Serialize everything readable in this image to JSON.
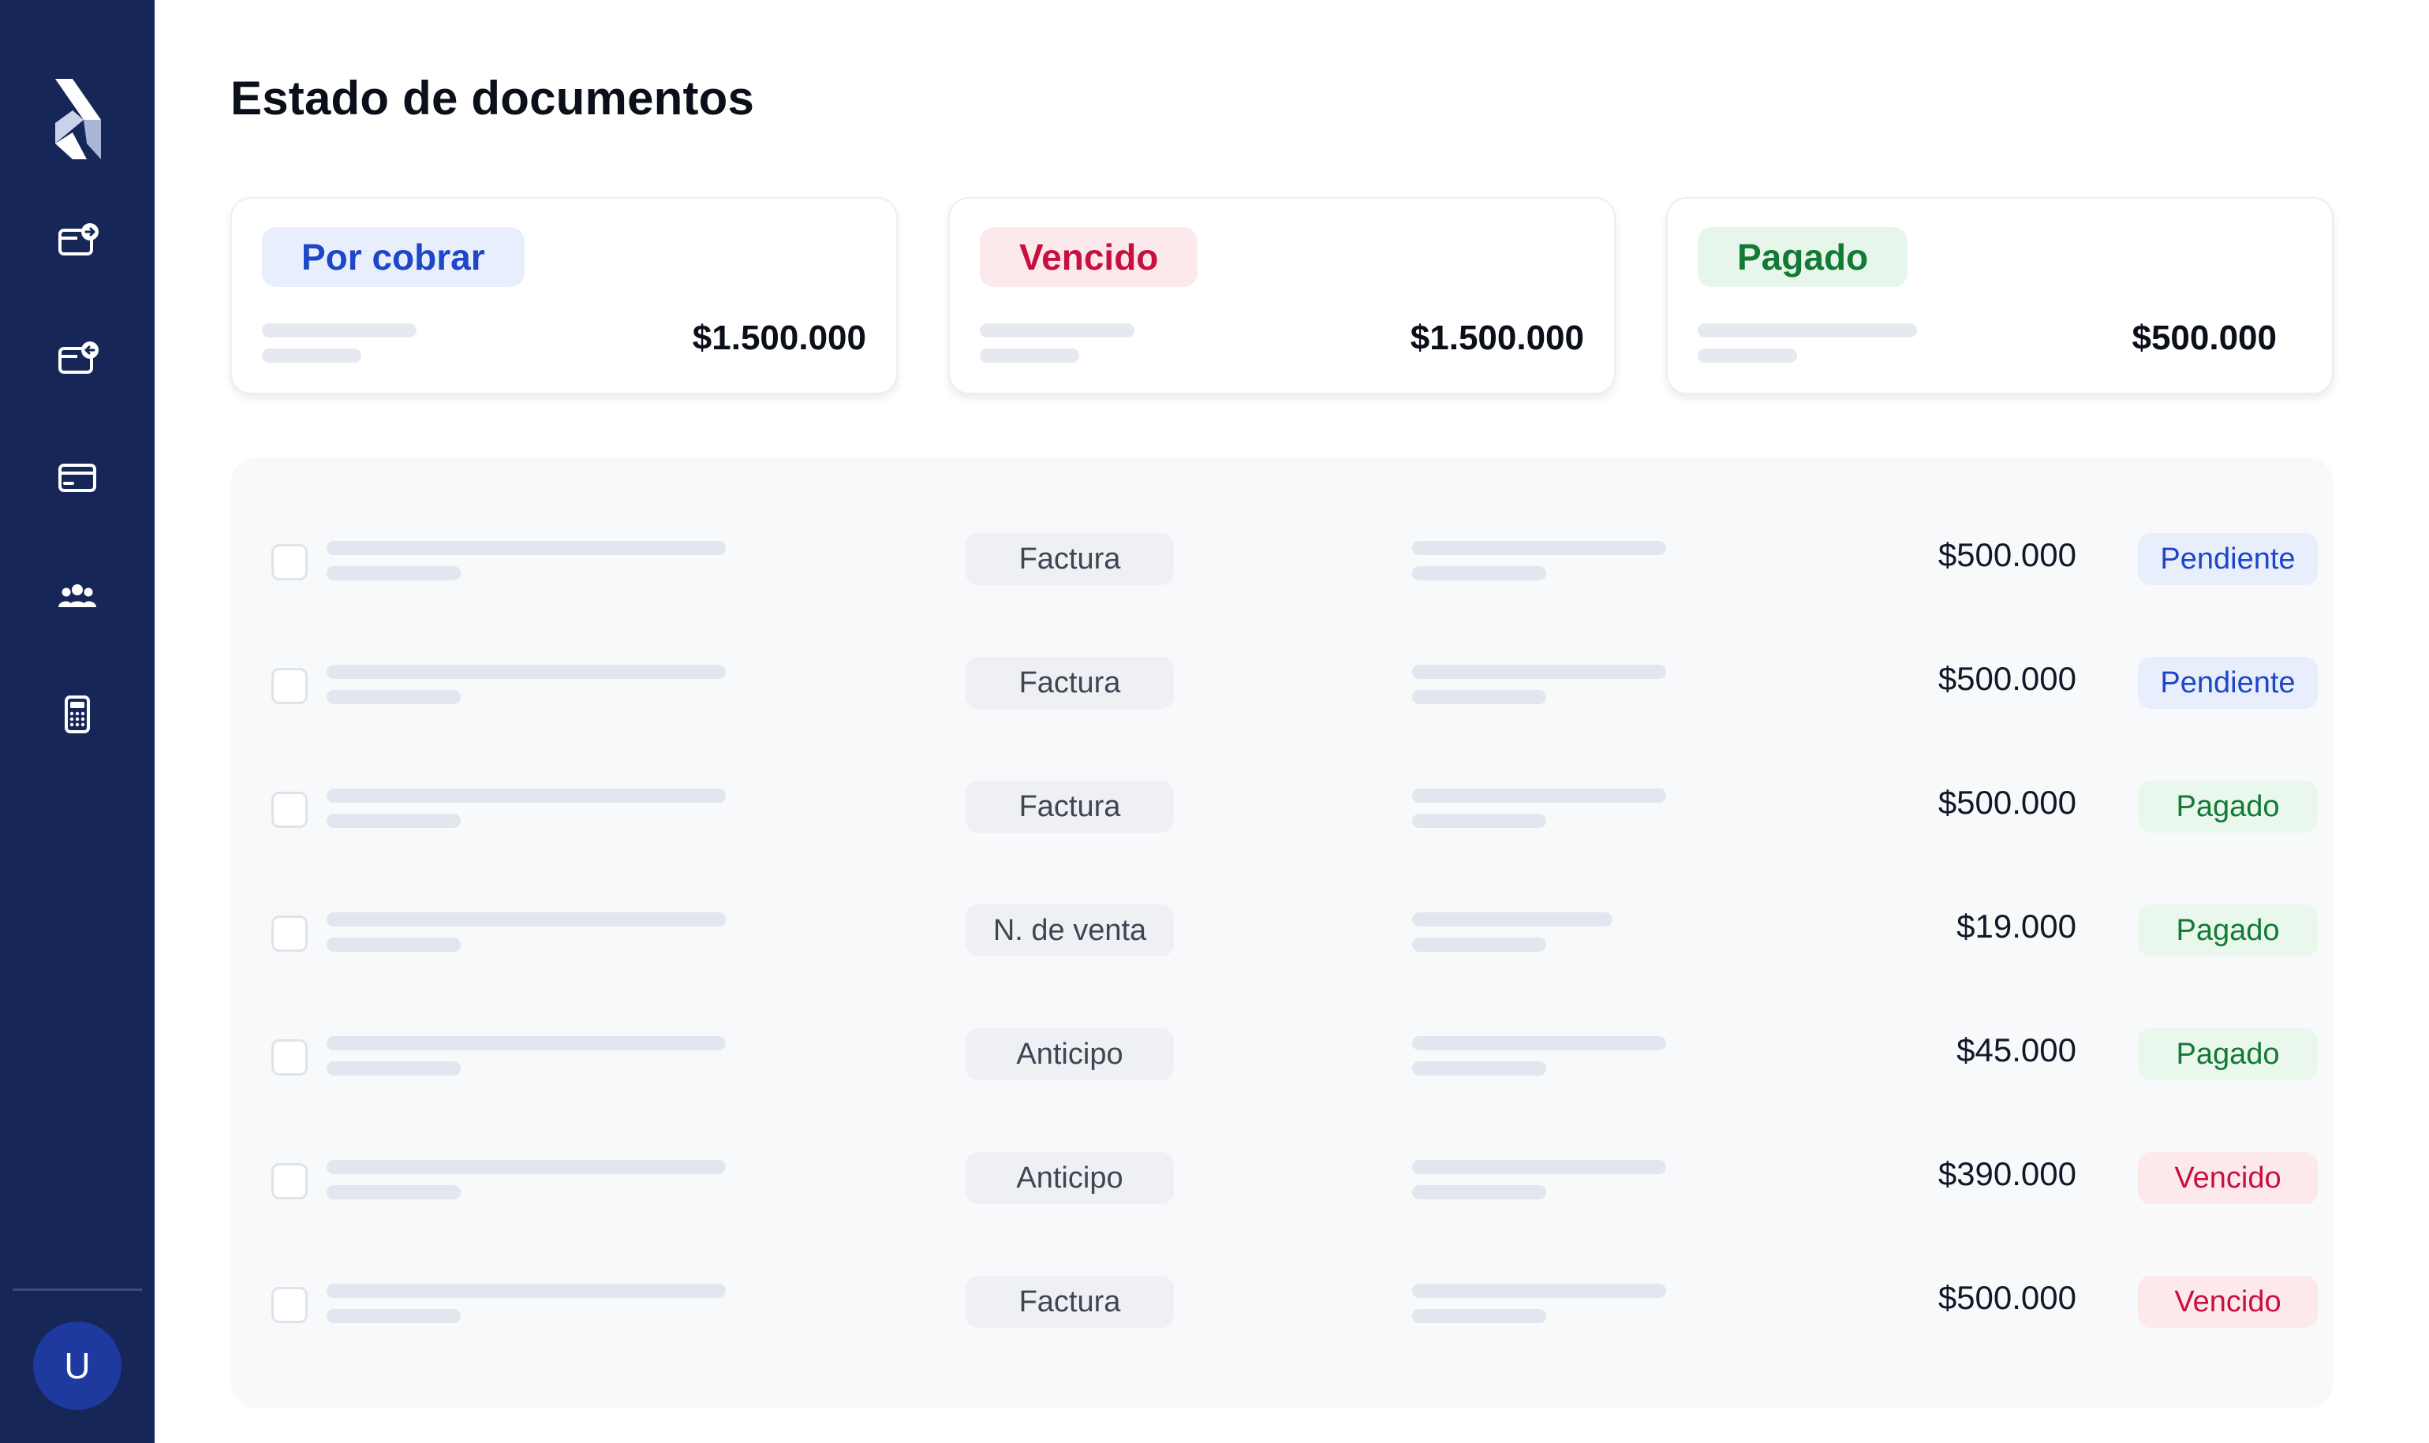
{
  "sidebar": {
    "logo_icon": "brand-x-logo",
    "nav": [
      {
        "icon": "wallet-outgoing-icon"
      },
      {
        "icon": "wallet-incoming-icon"
      },
      {
        "icon": "credit-card-icon"
      },
      {
        "icon": "users-group-icon"
      },
      {
        "icon": "calculator-icon"
      }
    ],
    "avatar_initial": "U"
  },
  "page": {
    "title": "Estado de documentos"
  },
  "summary": [
    {
      "label": "Por cobrar",
      "amount": "$1.500.000",
      "tone": "blue"
    },
    {
      "label": "Vencido",
      "amount": "$1.500.000",
      "tone": "red"
    },
    {
      "label": "Pagado",
      "amount": "$500.000",
      "tone": "green"
    }
  ],
  "documents": [
    {
      "type": "Factura",
      "amount": "$500.000",
      "status": "Pendiente",
      "status_tone": "pendiente"
    },
    {
      "type": "Factura",
      "amount": "$500.000",
      "status": "Pendiente",
      "status_tone": "pendiente"
    },
    {
      "type": "Factura",
      "amount": "$500.000",
      "status": "Pagado",
      "status_tone": "pagado"
    },
    {
      "type": "N. de venta",
      "amount": "$19.000",
      "status": "Pagado",
      "status_tone": "pagado"
    },
    {
      "type": "Anticipo",
      "amount": "$45.000",
      "status": "Pagado",
      "status_tone": "pagado"
    },
    {
      "type": "Anticipo",
      "amount": "$390.000",
      "status": "Vencido",
      "status_tone": "vencido"
    },
    {
      "type": "Factura",
      "amount": "$500.000",
      "status": "Vencido",
      "status_tone": "vencido"
    }
  ],
  "colors": {
    "sidebar_bg": "#162657",
    "blue": "#1d46c9",
    "red": "#c8103f",
    "green": "#137a35"
  }
}
